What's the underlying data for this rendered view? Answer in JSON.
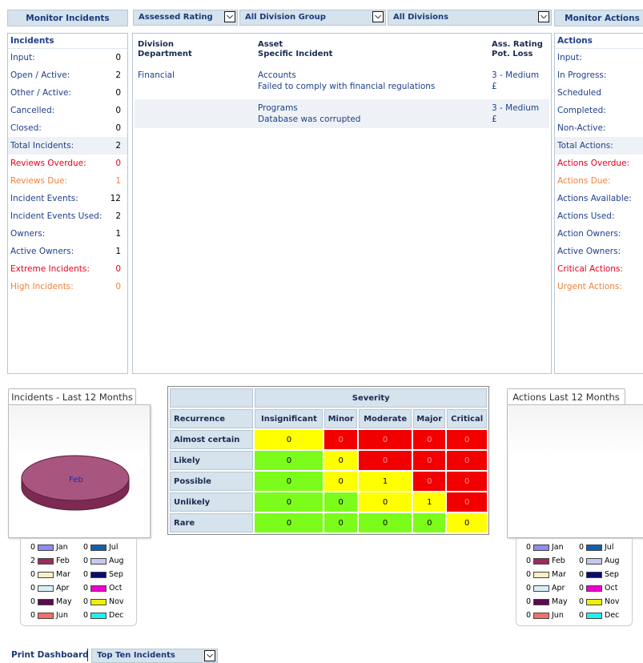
{
  "headers": {
    "monitor_incidents": "Monitor Incidents",
    "monitor_actions": "Monitor Actions"
  },
  "filters": {
    "rating": "Assessed Rating",
    "division_group": "All Division Group",
    "divisions": "All Divisions"
  },
  "incidents_panel": {
    "title": "Incidents",
    "rows": [
      {
        "label": "Input:",
        "value": "0",
        "tone": "blue"
      },
      {
        "label": "Open / Active:",
        "value": "2",
        "tone": "blue"
      },
      {
        "label": "Other / Active:",
        "value": "0",
        "tone": "blue"
      },
      {
        "label": "Cancelled:",
        "value": "0",
        "tone": "blue"
      },
      {
        "label": "Closed:",
        "value": "0",
        "tone": "blue"
      },
      {
        "label": "Total Incidents:",
        "value": "2",
        "tone": "blue"
      },
      {
        "label": "Reviews Overdue:",
        "value": "0",
        "tone": "red"
      },
      {
        "label": "Reviews Due:",
        "value": "1",
        "tone": "orange"
      },
      {
        "label": "Incident Events:",
        "value": "12",
        "tone": "blue"
      },
      {
        "label": "Incident Events Used:",
        "value": "2",
        "tone": "blue"
      },
      {
        "label": "Owners:",
        "value": "1",
        "tone": "blue"
      },
      {
        "label": "Active Owners:",
        "value": "1",
        "tone": "blue"
      },
      {
        "label": "Extreme Incidents:",
        "value": "0",
        "tone": "red"
      },
      {
        "label": "High Incidents:",
        "value": "0",
        "tone": "orange"
      }
    ]
  },
  "actions_panel": {
    "title": "Actions",
    "rows": [
      {
        "label": "Input:",
        "tone": "blue"
      },
      {
        "label": "In Progress:",
        "tone": "blue"
      },
      {
        "label": "Scheduled",
        "tone": "blue"
      },
      {
        "label": "Completed:",
        "tone": "blue"
      },
      {
        "label": "Non-Active:",
        "tone": "blue"
      },
      {
        "label": "Total Actions:",
        "tone": "blue"
      },
      {
        "label": "Actions Overdue:",
        "tone": "red"
      },
      {
        "label": "Actions Due:",
        "tone": "orange"
      },
      {
        "label": "Actions Available:",
        "tone": "blue"
      },
      {
        "label": "Actions Used:",
        "tone": "blue"
      },
      {
        "label": "Action Owners:",
        "tone": "blue"
      },
      {
        "label": "Active Owners:",
        "tone": "blue"
      },
      {
        "label": "Critical Actions:",
        "tone": "red"
      },
      {
        "label": "Urgent Actions:",
        "tone": "orange"
      }
    ]
  },
  "incident_table": {
    "col1_line1": "Division",
    "col1_line2": "Department",
    "col2_line1": "Asset",
    "col2_line2": "Specific Incident",
    "col3_line1": "Ass. Rating",
    "col3_line2": "Pot. Loss",
    "rows": [
      {
        "division": "Financial",
        "asset": "Accounts",
        "incident": "Failed to comply with financial regulations",
        "rating": "3 - Medium",
        "loss": "£"
      },
      {
        "division": "",
        "asset": "Programs",
        "incident": "Database was corrupted",
        "rating": "3 - Medium",
        "loss": "£"
      }
    ]
  },
  "incidents_chart": {
    "tab": "Incidents - Last 12 Months",
    "pie_label": "Feb",
    "legend": [
      {
        "count": "0",
        "month": "Jan",
        "color": "#8c8cf0"
      },
      {
        "count": "2",
        "month": "Feb",
        "color": "#9b2c5e"
      },
      {
        "count": "0",
        "month": "Mar",
        "color": "#f5f0c8"
      },
      {
        "count": "0",
        "month": "Apr",
        "color": "#d8f0f4"
      },
      {
        "count": "0",
        "month": "May",
        "color": "#5a0a50"
      },
      {
        "count": "0",
        "month": "Jun",
        "color": "#f07070"
      },
      {
        "count": "0",
        "month": "Jul",
        "color": "#1060b0"
      },
      {
        "count": "0",
        "month": "Aug",
        "color": "#c8c8ec"
      },
      {
        "count": "0",
        "month": "Sep",
        "color": "#0a0a70"
      },
      {
        "count": "0",
        "month": "Oct",
        "color": "#f000d0"
      },
      {
        "count": "0",
        "month": "Nov",
        "color": "#f0f000"
      },
      {
        "count": "0",
        "month": "Dec",
        "color": "#20f0f0"
      }
    ]
  },
  "actions_chart": {
    "tab": "Actions Last 12 Months",
    "legend": [
      {
        "count": "0",
        "month": "Jan",
        "color": "#8c8cf0"
      },
      {
        "count": "0",
        "month": "Feb",
        "color": "#9b2c5e"
      },
      {
        "count": "0",
        "month": "Mar",
        "color": "#f5f0c8"
      },
      {
        "count": "0",
        "month": "Apr",
        "color": "#d8f0f4"
      },
      {
        "count": "0",
        "month": "May",
        "color": "#5a0a50"
      },
      {
        "count": "0",
        "month": "Jun",
        "color": "#f07070"
      },
      {
        "count": "0",
        "month": "Jul",
        "color": "#1060b0"
      },
      {
        "count": "0",
        "month": "Aug",
        "color": "#c8c8ec"
      },
      {
        "count": "0",
        "month": "Sep",
        "color": "#0a0a70"
      },
      {
        "count": "0",
        "month": "Oct",
        "color": "#f000d0"
      },
      {
        "count": "0",
        "month": "Nov",
        "color": "#f0f000"
      },
      {
        "count": "0",
        "month": "Dec",
        "color": "#20f0f0"
      }
    ]
  },
  "matrix": {
    "severity_label": "Severity",
    "recurrence_label": "Recurrence",
    "columns": [
      "Insignificant",
      "Minor",
      "Moderate",
      "Major",
      "Critical"
    ],
    "rows": [
      {
        "label": "Almost certain",
        "cells": [
          {
            "v": "0",
            "c": "y"
          },
          {
            "v": "0",
            "c": "r"
          },
          {
            "v": "0",
            "c": "r"
          },
          {
            "v": "0",
            "c": "r"
          },
          {
            "v": "0",
            "c": "r"
          }
        ]
      },
      {
        "label": "Likely",
        "cells": [
          {
            "v": "0",
            "c": "g"
          },
          {
            "v": "0",
            "c": "y"
          },
          {
            "v": "0",
            "c": "r"
          },
          {
            "v": "0",
            "c": "r"
          },
          {
            "v": "0",
            "c": "r"
          }
        ]
      },
      {
        "label": "Possible",
        "cells": [
          {
            "v": "0",
            "c": "g"
          },
          {
            "v": "0",
            "c": "y"
          },
          {
            "v": "1",
            "c": "y"
          },
          {
            "v": "0",
            "c": "r"
          },
          {
            "v": "0",
            "c": "r"
          }
        ]
      },
      {
        "label": "Unlikely",
        "cells": [
          {
            "v": "0",
            "c": "g"
          },
          {
            "v": "0",
            "c": "g"
          },
          {
            "v": "0",
            "c": "y"
          },
          {
            "v": "1",
            "c": "y"
          },
          {
            "v": "0",
            "c": "r"
          }
        ]
      },
      {
        "label": "Rare",
        "cells": [
          {
            "v": "0",
            "c": "g"
          },
          {
            "v": "0",
            "c": "g"
          },
          {
            "v": "0",
            "c": "g"
          },
          {
            "v": "0",
            "c": "g"
          },
          {
            "v": "0",
            "c": "y"
          }
        ]
      }
    ]
  },
  "footer": {
    "print_label": "Print Dashboard",
    "report_select": "Top Ten Incidents"
  }
}
